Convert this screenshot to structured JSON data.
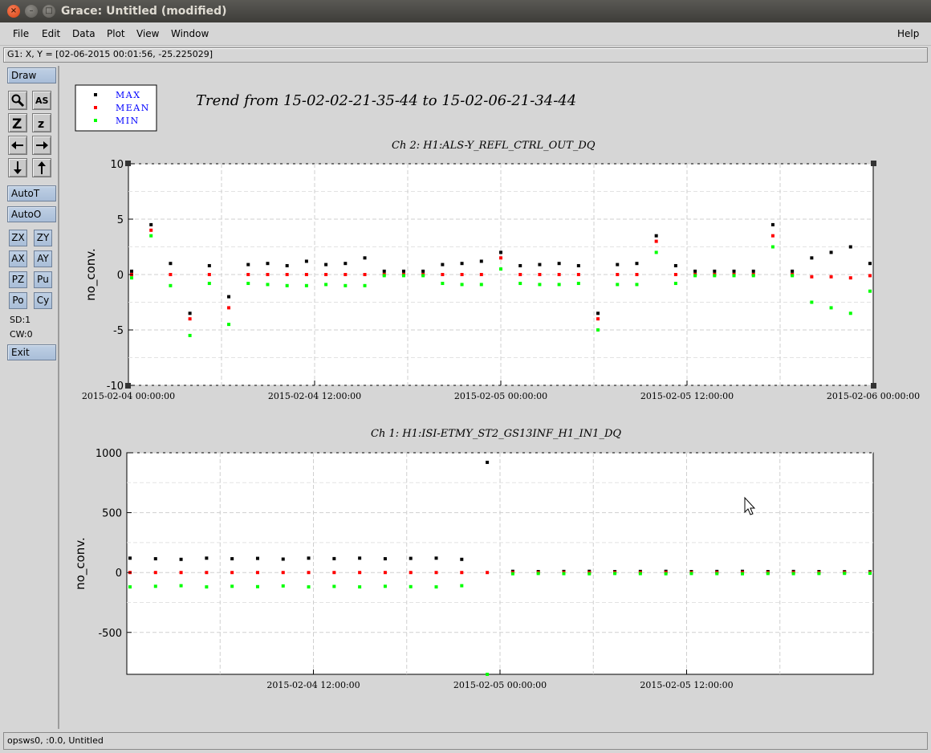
{
  "window": {
    "title": "Grace: Untitled (modified)",
    "close_glyph": "×",
    "min_glyph": "–",
    "max_glyph": "□"
  },
  "menu": {
    "file": "File",
    "edit": "Edit",
    "data": "Data",
    "plot": "Plot",
    "view": "View",
    "window": "Window",
    "help": "Help"
  },
  "locator": "G1: X, Y = [02-06-2015 00:01:56, -25.225029]",
  "toolbar": {
    "draw": "Draw",
    "autot": "AutoT",
    "autoo": "AutoO",
    "zx": "ZX",
    "zy": "ZY",
    "ax": "AX",
    "ay": "AY",
    "pz": "PZ",
    "pu": "Pu",
    "po": "Po",
    "cy": "Cy",
    "sd": "SD:1",
    "cw": "CW:0",
    "exit": "Exit",
    "icons": [
      "zoom-icon",
      "autoscale-icon",
      "zoom-in-icon",
      "zoom-out-icon",
      "left-arrow-icon",
      "right-arrow-icon",
      "down-arrow-icon",
      "up-arrow-icon"
    ],
    "autoscale_glyph": "AS",
    "zoom_in_glyph": "Z",
    "zoom_out_glyph": "z"
  },
  "status": "opsws0, :0.0, Untitled",
  "colors": {
    "max": "#000000",
    "mean": "#ff0000",
    "min": "#00ff00",
    "legend_text": "#0000ff"
  },
  "chart_data": [
    {
      "type": "scatter",
      "title": "Ch 2: H1:ALS-Y_REFL_CTRL_OUT_DQ",
      "supertitle": "Trend from 15-02-02-21-35-44 to 15-02-06-21-34-44",
      "ylabel": "no_conv.",
      "xlabel": "",
      "ylim": [
        -10,
        10
      ],
      "yticks": [
        "10",
        "5",
        "0",
        "-5",
        "-10"
      ],
      "xticks": [
        "2015-02-04 00:00:00",
        "2015-02-04 12:00:00",
        "2015-02-05 00:00:00",
        "2015-02-05 12:00:00",
        "2015-02-06 00:00:00"
      ],
      "grid": true,
      "legend": [
        "MAX",
        "MEAN",
        "MIN"
      ],
      "legend_position": "top-left",
      "series": [
        {
          "name": "MAX",
          "values": [
            0.3,
            4.5,
            1.0,
            -3.5,
            0.8,
            -2.0,
            0.9,
            1.0,
            0.8,
            1.2,
            0.9,
            1.0,
            1.5,
            0.3,
            0.3,
            0.3,
            0.9,
            1.0,
            1.2,
            2.0,
            0.8,
            0.9,
            1.0,
            0.8,
            -3.5,
            0.9,
            1.0,
            3.5,
            0.8,
            0.3,
            0.3,
            0.3,
            0.3,
            4.5,
            0.3,
            1.5,
            2.0,
            2.5,
            1.0
          ]
        },
        {
          "name": "MEAN",
          "values": [
            0.0,
            4.0,
            0.0,
            -4.0,
            0.0,
            -3.0,
            0.0,
            0.0,
            0.0,
            0.0,
            0.0,
            0.0,
            0.0,
            0.0,
            0.0,
            0.0,
            0.0,
            0.0,
            0.0,
            1.5,
            0.0,
            0.0,
            0.0,
            0.0,
            -4.0,
            0.0,
            0.0,
            3.0,
            0.0,
            0.0,
            0.0,
            0.0,
            0.0,
            3.5,
            0.0,
            -0.2,
            -0.2,
            -0.3,
            -0.1
          ]
        },
        {
          "name": "MIN",
          "values": [
            -0.3,
            3.5,
            -1.0,
            -5.5,
            -0.8,
            -4.5,
            -0.8,
            -0.9,
            -1.0,
            -1.0,
            -0.9,
            -1.0,
            -1.0,
            -0.1,
            -0.1,
            -0.1,
            -0.8,
            -0.9,
            -0.9,
            0.5,
            -0.8,
            -0.9,
            -0.9,
            -0.8,
            -5.0,
            -0.9,
            -0.9,
            2.0,
            -0.8,
            -0.1,
            -0.1,
            -0.1,
            -0.1,
            2.5,
            -0.1,
            -2.5,
            -3.0,
            -3.5,
            -1.5
          ]
        }
      ]
    },
    {
      "type": "scatter",
      "title": "Ch 1: H1:ISI-ETMY_ST2_GS13INF_H1_IN1_DQ",
      "ylabel": "no_conv.",
      "xlabel": "",
      "ylim": [
        -850,
        1000
      ],
      "yticks": [
        "1000",
        "500",
        "0",
        "-500"
      ],
      "xticks": [
        "2015-02-04 12:00:00",
        "2015-02-05 00:00:00",
        "2015-02-05 12:00:00"
      ],
      "grid": true,
      "series": [
        {
          "name": "MAX",
          "values": [
            120,
            115,
            110,
            120,
            115,
            118,
            112,
            120,
            116,
            120,
            115,
            118,
            120,
            110,
            920,
            10,
            8,
            9,
            10,
            8,
            9,
            10,
            8,
            9,
            10,
            8,
            9,
            8,
            7,
            6
          ]
        },
        {
          "name": "MEAN",
          "values": [
            0,
            0,
            0,
            0,
            0,
            0,
            0,
            0,
            0,
            0,
            0,
            0,
            0,
            0,
            0,
            0,
            0,
            0,
            0,
            0,
            0,
            0,
            0,
            0,
            0,
            0,
            0,
            0,
            0,
            0
          ]
        },
        {
          "name": "MIN",
          "values": [
            -120,
            -115,
            -110,
            -120,
            -115,
            -118,
            -112,
            -120,
            -116,
            -120,
            -115,
            -118,
            -120,
            -110,
            -850,
            -10,
            -8,
            -9,
            -10,
            -8,
            -9,
            -10,
            -8,
            -9,
            -10,
            -8,
            -9,
            -8,
            -7,
            -6
          ]
        }
      ]
    }
  ]
}
